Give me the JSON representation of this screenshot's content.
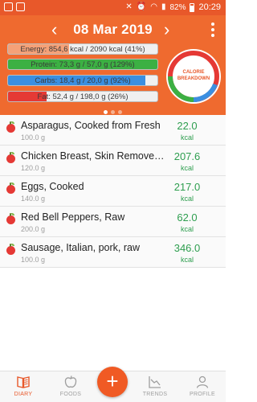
{
  "status_bar": {
    "battery": "82%",
    "time": "20:29"
  },
  "header": {
    "date": "08 Mar 2019",
    "prev_icon": "chevron-left-icon",
    "next_icon": "chevron-right-icon",
    "menu_icon": "more-vertical-icon"
  },
  "macros": [
    {
      "label": "Energy: 854,6 kcal  /  2090 kcal (41%)",
      "fraction": 0.41,
      "color": "#f5a178"
    },
    {
      "label": "Protein: 73,3 g  /  57,0 g (129%)",
      "fraction": 1.0,
      "color": "#3cb043"
    },
    {
      "label": "Carbs: 18,4 g  /  20,0 g (92%)",
      "fraction": 0.92,
      "color": "#3b8fe0"
    },
    {
      "label": "Fat: 52,4 g  /  198,0 g (26%)",
      "fraction": 0.26,
      "color": "#e53935"
    }
  ],
  "calorie_breakdown": {
    "label_line1": "CALORIE",
    "label_line2": "BREAKDOWN",
    "segments": [
      {
        "name": "protein",
        "color": "#3cb043"
      },
      {
        "name": "carbs",
        "color": "#3b8fe0"
      },
      {
        "name": "fat",
        "color": "#e53935"
      }
    ]
  },
  "pager": {
    "count": 3,
    "active": 0
  },
  "foods": [
    {
      "name": "Asparagus, Cooked from Fresh",
      "qty": "100.0 g",
      "kcal": "22.0",
      "unit": "kcal"
    },
    {
      "name": "Chicken Breast, Skin Removed ...",
      "qty": "120.0 g",
      "kcal": "207.6",
      "unit": "kcal"
    },
    {
      "name": "Eggs, Cooked",
      "qty": "140.0 g",
      "kcal": "217.0",
      "unit": "kcal"
    },
    {
      "name": "Red Bell Peppers, Raw",
      "qty": "200.0 g",
      "kcal": "62.0",
      "unit": "kcal"
    },
    {
      "name": "Sausage, Italian, pork, raw",
      "qty": "100.0 g",
      "kcal": "346.0",
      "unit": "kcal"
    }
  ],
  "nav": {
    "diary": "DIARY",
    "foods": "FOODS",
    "add": "+",
    "trends": "TRENDS",
    "profile": "PROFILE",
    "accent": "#e8582a"
  }
}
